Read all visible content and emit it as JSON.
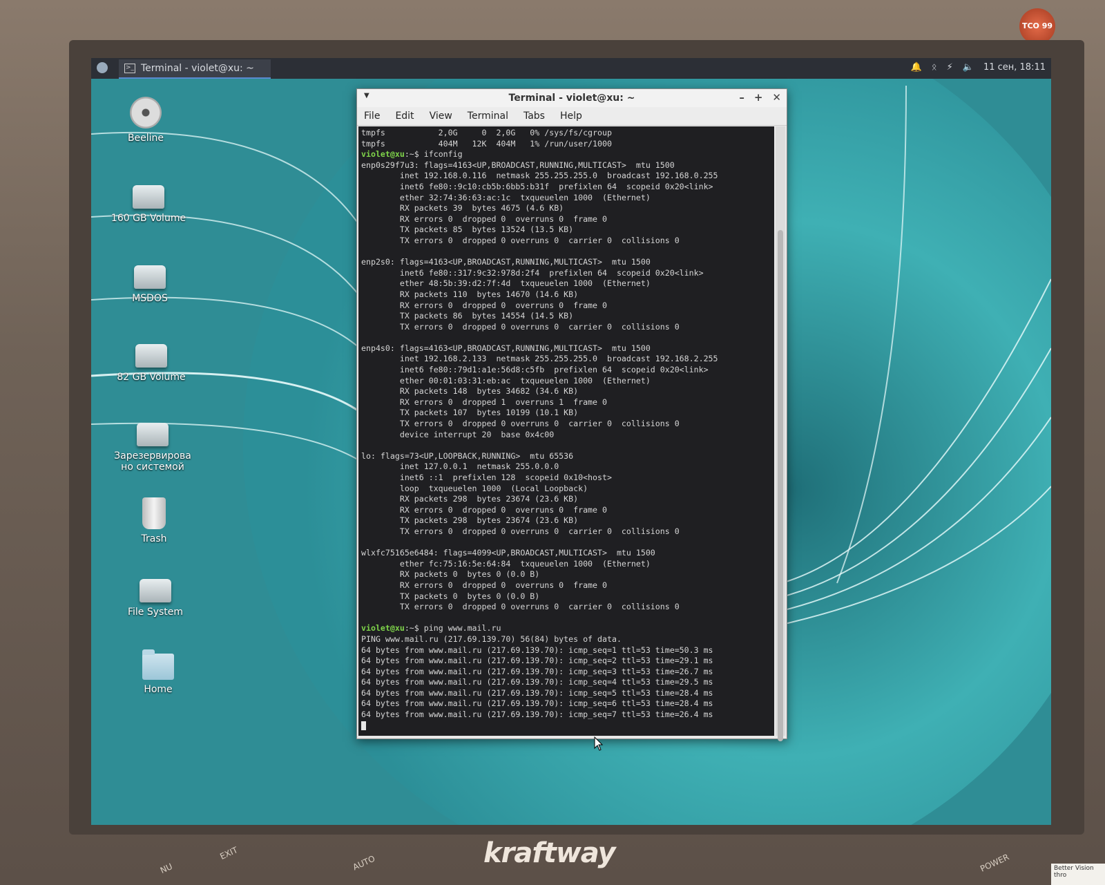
{
  "panel": {
    "task_title": "Terminal - violet@xu: ~",
    "clock": "11 сен, 18:11",
    "tray_icons": [
      "bell-icon",
      "bluetooth-icon",
      "power-icon",
      "volume-icon"
    ]
  },
  "desktop": {
    "icons": [
      {
        "label": "Beeline",
        "icon": "disc-icon"
      },
      {
        "label": "160 GB Volume",
        "icon": "drive-icon"
      },
      {
        "label": "MSDOS",
        "icon": "drive-icon"
      },
      {
        "label": "82 GB Volume",
        "icon": "drive-icon"
      },
      {
        "label": "Зарезервирова но системой",
        "icon": "drive-icon"
      },
      {
        "label": "Trash",
        "icon": "trash-icon"
      },
      {
        "label": "File System",
        "icon": "drive-icon"
      },
      {
        "label": "Home",
        "icon": "home-folder-icon"
      }
    ]
  },
  "terminal": {
    "title": "Terminal - violet@xu: ~",
    "menu": [
      "File",
      "Edit",
      "View",
      "Terminal",
      "Tabs",
      "Help"
    ],
    "prompt": "violet@xu",
    "prompt_suffix": ":~$ ",
    "lines_top": [
      "tmpfs           2,0G     0  2,0G   0% /sys/fs/cgroup",
      "tmpfs           404M   12K  404M   1% /run/user/1000"
    ],
    "cmd1": "ifconfig",
    "ifconfig_output": [
      "enp0s29f7u3: flags=4163<UP,BROADCAST,RUNNING,MULTICAST>  mtu 1500",
      "        inet 192.168.0.116  netmask 255.255.255.0  broadcast 192.168.0.255",
      "        inet6 fe80::9c10:cb5b:6bb5:b31f  prefixlen 64  scopeid 0x20<link>",
      "        ether 32:74:36:63:ac:1c  txqueuelen 1000  (Ethernet)",
      "        RX packets 39  bytes 4675 (4.6 KB)",
      "        RX errors 0  dropped 0  overruns 0  frame 0",
      "        TX packets 85  bytes 13524 (13.5 KB)",
      "        TX errors 0  dropped 0 overruns 0  carrier 0  collisions 0",
      "",
      "enp2s0: flags=4163<UP,BROADCAST,RUNNING,MULTICAST>  mtu 1500",
      "        inet6 fe80::317:9c32:978d:2f4  prefixlen 64  scopeid 0x20<link>",
      "        ether 48:5b:39:d2:7f:4d  txqueuelen 1000  (Ethernet)",
      "        RX packets 110  bytes 14670 (14.6 KB)",
      "        RX errors 0  dropped 0  overruns 0  frame 0",
      "        TX packets 86  bytes 14554 (14.5 KB)",
      "        TX errors 0  dropped 0 overruns 0  carrier 0  collisions 0",
      "",
      "enp4s0: flags=4163<UP,BROADCAST,RUNNING,MULTICAST>  mtu 1500",
      "        inet 192.168.2.133  netmask 255.255.255.0  broadcast 192.168.2.255",
      "        inet6 fe80::79d1:a1e:56d8:c5fb  prefixlen 64  scopeid 0x20<link>",
      "        ether 00:01:03:31:eb:ac  txqueuelen 1000  (Ethernet)",
      "        RX packets 148  bytes 34682 (34.6 KB)",
      "        RX errors 0  dropped 1  overruns 1  frame 0",
      "        TX packets 107  bytes 10199 (10.1 KB)",
      "        TX errors 0  dropped 0 overruns 0  carrier 0  collisions 0",
      "        device interrupt 20  base 0x4c00",
      "",
      "lo: flags=73<UP,LOOPBACK,RUNNING>  mtu 65536",
      "        inet 127.0.0.1  netmask 255.0.0.0",
      "        inet6 ::1  prefixlen 128  scopeid 0x10<host>",
      "        loop  txqueuelen 1000  (Local Loopback)",
      "        RX packets 298  bytes 23674 (23.6 KB)",
      "        RX errors 0  dropped 0  overruns 0  frame 0",
      "        TX packets 298  bytes 23674 (23.6 KB)",
      "        TX errors 0  dropped 0 overruns 0  carrier 0  collisions 0",
      "",
      "wlxfc75165e6484: flags=4099<UP,BROADCAST,MULTICAST>  mtu 1500",
      "        ether fc:75:16:5e:64:84  txqueuelen 1000  (Ethernet)",
      "        RX packets 0  bytes 0 (0.0 B)",
      "        RX errors 0  dropped 0  overruns 0  frame 0",
      "        TX packets 0  bytes 0 (0.0 B)",
      "        TX errors 0  dropped 0 overruns 0  carrier 0  collisions 0",
      ""
    ],
    "cmd2": "ping www.mail.ru",
    "ping_output": [
      "PING www.mail.ru (217.69.139.70) 56(84) bytes of data.",
      "64 bytes from www.mail.ru (217.69.139.70): icmp_seq=1 ttl=53 time=50.3 ms",
      "64 bytes from www.mail.ru (217.69.139.70): icmp_seq=2 ttl=53 time=29.1 ms",
      "64 bytes from www.mail.ru (217.69.139.70): icmp_seq=3 ttl=53 time=26.7 ms",
      "64 bytes from www.mail.ru (217.69.139.70): icmp_seq=4 ttl=53 time=29.5 ms",
      "64 bytes from www.mail.ru (217.69.139.70): icmp_seq=5 ttl=53 time=28.4 ms",
      "64 bytes from www.mail.ru (217.69.139.70): icmp_seq=6 ttl=53 time=28.4 ms",
      "64 bytes from www.mail.ru (217.69.139.70): icmp_seq=7 ttl=53 time=26.4 ms"
    ]
  },
  "monitor": {
    "brand": "kraftway",
    "labels": [
      "NU",
      "EXIT",
      "AUTO",
      "POWER"
    ],
    "sticker": "Better Vision thro",
    "badge": "TCO 99"
  },
  "colors": {
    "prompt": "#7fd44a",
    "wallpaper_teal": "#1f8a8f",
    "terminal_bg": "#1f1f22"
  }
}
